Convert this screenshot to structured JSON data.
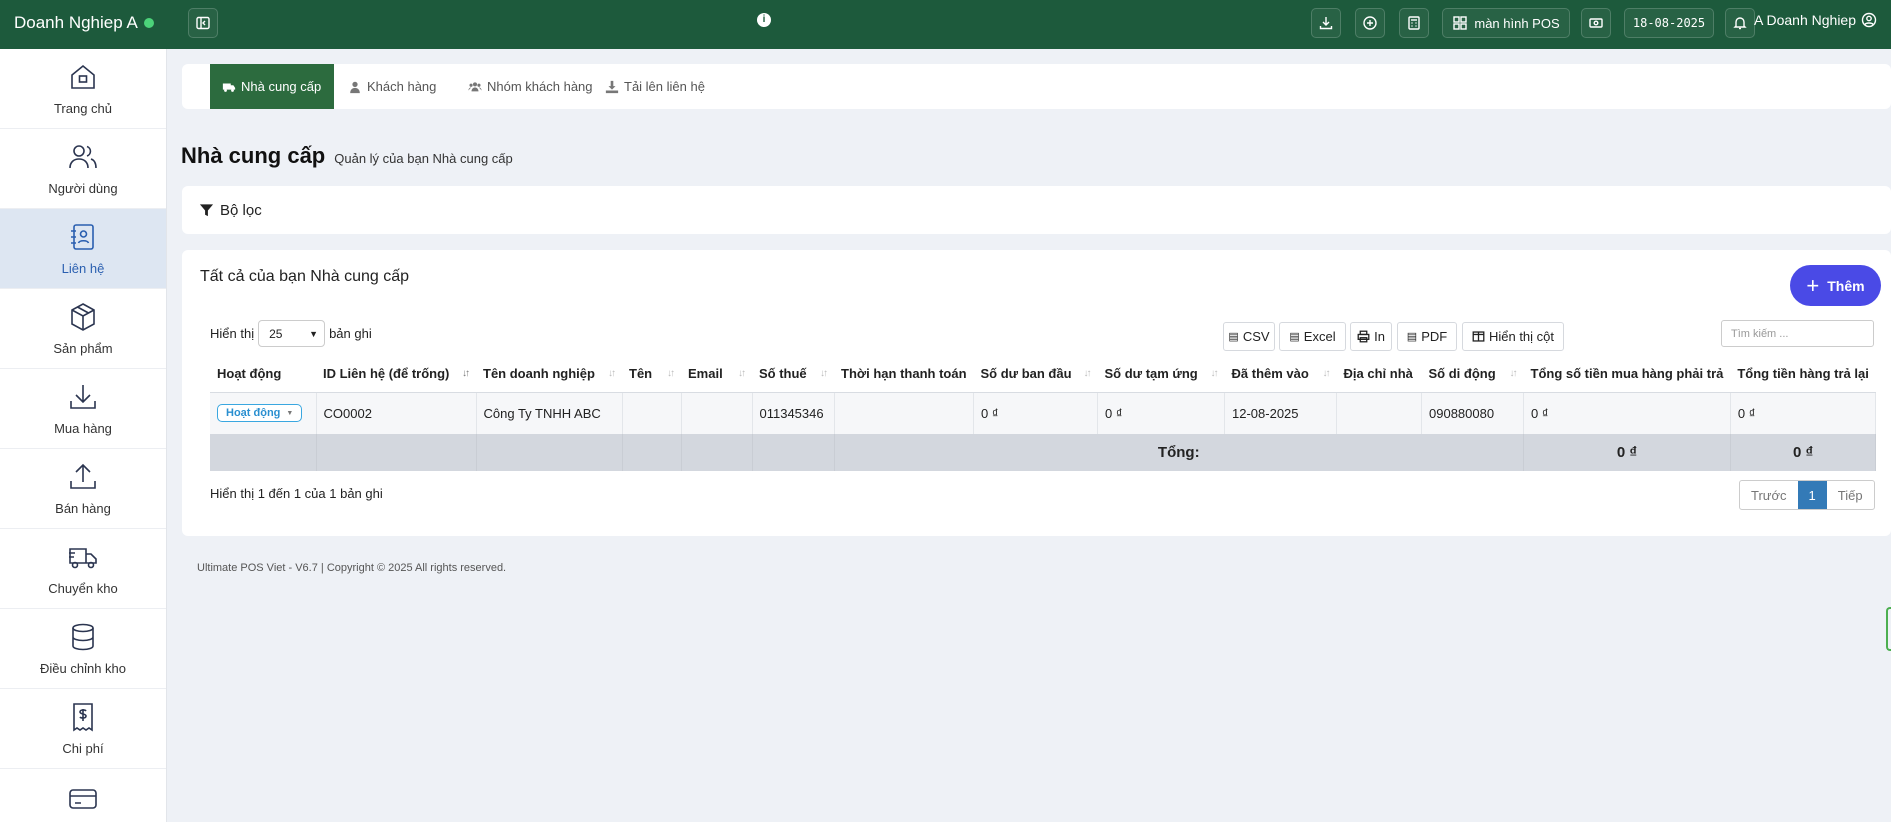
{
  "header": {
    "brand": "Doanh Nghiep A",
    "pos_label": "màn hình POS",
    "date": "18-08-2025",
    "user": "A Doanh Nghiep"
  },
  "sidebar": {
    "items": [
      {
        "label": "Trang chủ",
        "icon": "home-icon"
      },
      {
        "label": "Người dùng",
        "icon": "users-icon"
      },
      {
        "label": "Liên hệ",
        "icon": "contact-book-icon",
        "active": true
      },
      {
        "label": "Sản phẩm",
        "icon": "box-icon"
      },
      {
        "label": "Mua hàng",
        "icon": "download-arrow-icon"
      },
      {
        "label": "Bán hàng",
        "icon": "upload-arrow-icon"
      },
      {
        "label": "Chuyển kho",
        "icon": "truck-icon"
      },
      {
        "label": "Điều chỉnh kho",
        "icon": "database-icon"
      },
      {
        "label": "Chi phí",
        "icon": "receipt-dollar-icon"
      }
    ]
  },
  "tabs": [
    {
      "label": "Nhà cung cấp",
      "active": true
    },
    {
      "label": "Khách hàng"
    },
    {
      "label": "Nhóm khách hàng"
    },
    {
      "label": "Tải lên liên hệ"
    }
  ],
  "page": {
    "title": "Nhà cung cấp",
    "subtitle": "Quản lý của bạn Nhà cung cấp",
    "filter_label": "Bộ lọc",
    "card_title": "Tất cả của bạn Nhà cung cấp",
    "add_label": "Thêm"
  },
  "table_controls": {
    "show_prefix": "Hiển thị",
    "page_size": "25",
    "show_suffix": "bản ghi",
    "search_placeholder": "Tìm kiếm ...",
    "export": [
      "CSV",
      "Excel",
      "In",
      "PDF",
      "Hiển thị cột"
    ]
  },
  "table": {
    "columns": [
      "Hoạt động",
      "ID Liên hệ (để trống)",
      "Tên doanh nghiệp",
      "Tên",
      "Email",
      "Số thuế",
      "Thời hạn thanh toán",
      "Số dư ban đầu",
      "Số dư tạm ứng",
      "Đã thêm vào",
      "Địa chỉ nhà",
      "Số di động",
      "Tổng số tiền mua hàng phải trả",
      "Tổng tiền hàng trả lại"
    ],
    "rows": [
      [
        "Hoạt động",
        "CO0002",
        "Công Ty TNHH ABC",
        "",
        "",
        "011345346",
        "",
        "0 ₫",
        "0 ₫",
        "12-08-2025",
        "",
        "090880080",
        "0 ₫",
        "0 ₫"
      ]
    ],
    "footer": {
      "label": "Tổng:",
      "total_purchase": "0 ₫",
      "total_return": "0 ₫"
    }
  },
  "pagination": {
    "info": "Hiển thị 1 đến 1 của 1 bản ghi",
    "prev": "Trước",
    "current": "1",
    "next": "Tiếp"
  },
  "footer": {
    "text": "Ultimate POS Viet - V6.7 | Copyright © 2025 All rights reserved."
  }
}
